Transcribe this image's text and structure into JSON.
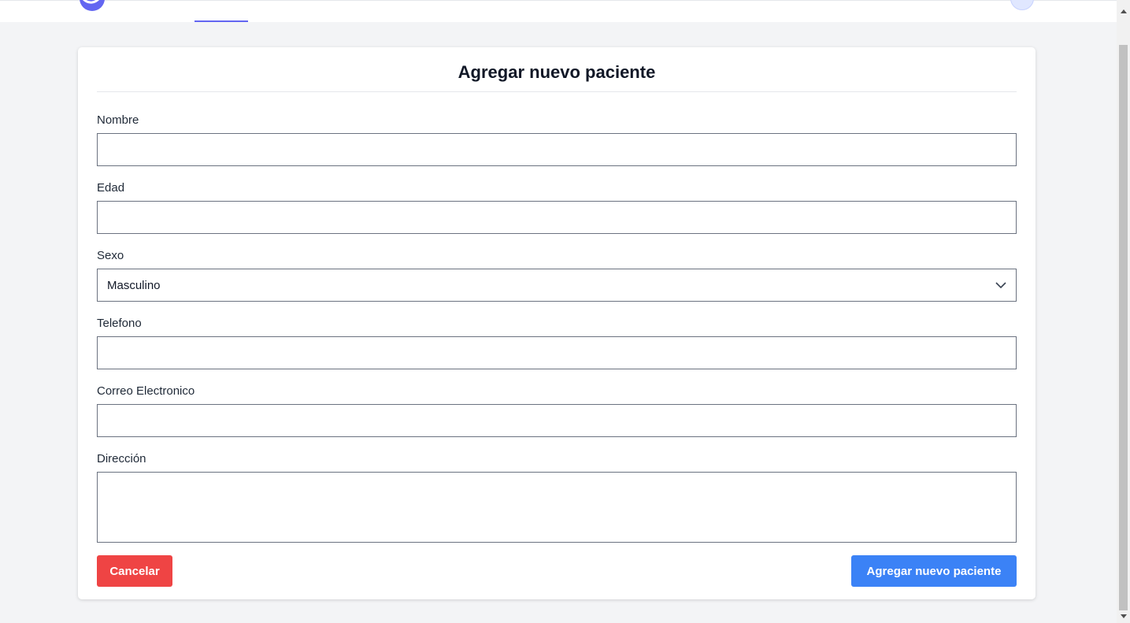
{
  "form": {
    "title": "Agregar nuevo paciente",
    "fields": [
      {
        "label": "Nombre",
        "value": ""
      },
      {
        "label": "Edad",
        "value": ""
      },
      {
        "label": "Sexo",
        "value": "Masculino"
      },
      {
        "label": "Telefono",
        "value": ""
      },
      {
        "label": "Correo Electronico",
        "value": ""
      },
      {
        "label": "Dirección",
        "value": ""
      }
    ],
    "cancel_label": "Cancelar",
    "submit_label": "Agregar nuevo paciente"
  },
  "colors": {
    "accent": "#6366f1",
    "cancel": "#ef4444",
    "submit": "#3b82f6",
    "background": "#f3f4f6"
  }
}
